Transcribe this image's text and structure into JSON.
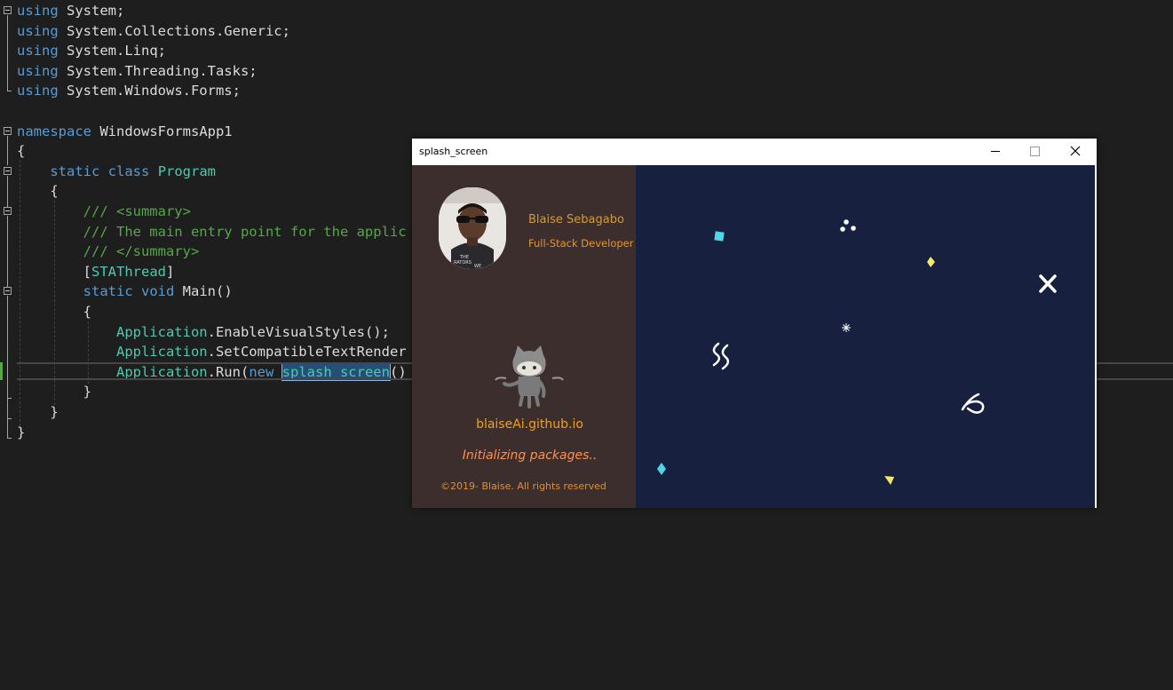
{
  "editor": {
    "lines": [
      {
        "tokens": [
          {
            "t": "using",
            "c": "kw"
          },
          {
            "t": " System;",
            "c": "id"
          }
        ]
      },
      {
        "tokens": [
          {
            "t": "using",
            "c": "kw"
          },
          {
            "t": " System.Collections.Generic;",
            "c": "id"
          }
        ]
      },
      {
        "tokens": [
          {
            "t": "using",
            "c": "kw"
          },
          {
            "t": " System.Linq;",
            "c": "id"
          }
        ]
      },
      {
        "tokens": [
          {
            "t": "using",
            "c": "kw"
          },
          {
            "t": " System.Threading.Tasks;",
            "c": "id"
          }
        ]
      },
      {
        "tokens": [
          {
            "t": "using",
            "c": "kw"
          },
          {
            "t": " System.Windows.Forms;",
            "c": "id"
          }
        ]
      },
      {
        "tokens": []
      },
      {
        "tokens": [
          {
            "t": "namespace",
            "c": "kw"
          },
          {
            "t": " WindowsFormsApp1",
            "c": "id"
          }
        ]
      },
      {
        "tokens": [
          {
            "t": "{",
            "c": "id"
          }
        ]
      },
      {
        "tokens": [
          {
            "t": "    ",
            "c": "id"
          },
          {
            "t": "static",
            "c": "kw"
          },
          {
            "t": " ",
            "c": "id"
          },
          {
            "t": "class",
            "c": "kw"
          },
          {
            "t": " ",
            "c": "id"
          },
          {
            "t": "Program",
            "c": "ty"
          }
        ]
      },
      {
        "tokens": [
          {
            "t": "    {",
            "c": "id"
          }
        ]
      },
      {
        "tokens": [
          {
            "t": "        /// <summary>",
            "c": "cm"
          }
        ]
      },
      {
        "tokens": [
          {
            "t": "        /// The main entry point for the applic",
            "c": "cm"
          }
        ]
      },
      {
        "tokens": [
          {
            "t": "        /// </summary>",
            "c": "cm"
          }
        ]
      },
      {
        "tokens": [
          {
            "t": "        [",
            "c": "id"
          },
          {
            "t": "STAThread",
            "c": "ty"
          },
          {
            "t": "]",
            "c": "id"
          }
        ]
      },
      {
        "tokens": [
          {
            "t": "        ",
            "c": "id"
          },
          {
            "t": "static",
            "c": "kw"
          },
          {
            "t": " ",
            "c": "id"
          },
          {
            "t": "void",
            "c": "kw"
          },
          {
            "t": " Main()",
            "c": "id"
          }
        ]
      },
      {
        "tokens": [
          {
            "t": "        {",
            "c": "id"
          }
        ]
      },
      {
        "tokens": [
          {
            "t": "            ",
            "c": "id"
          },
          {
            "t": "Application",
            "c": "ty"
          },
          {
            "t": ".EnableVisualStyles();",
            "c": "id"
          }
        ]
      },
      {
        "tokens": [
          {
            "t": "            ",
            "c": "id"
          },
          {
            "t": "Application",
            "c": "ty"
          },
          {
            "t": ".SetCompatibleTextRender",
            "c": "id"
          }
        ]
      },
      {
        "tokens": [
          {
            "t": "            ",
            "c": "id"
          },
          {
            "t": "Application",
            "c": "ty"
          },
          {
            "t": ".Run(",
            "c": "id"
          },
          {
            "t": "new",
            "c": "kw"
          },
          {
            "t": " ",
            "c": "id"
          },
          {
            "t": "splash_screen",
            "c": "ty sel"
          },
          {
            "t": "()",
            "c": "id"
          }
        ]
      },
      {
        "tokens": [
          {
            "t": "        }",
            "c": "id"
          }
        ]
      },
      {
        "tokens": [
          {
            "t": "    }",
            "c": "id"
          }
        ]
      },
      {
        "tokens": [
          {
            "t": "}",
            "c": "id"
          }
        ]
      }
    ]
  },
  "splash": {
    "window_title": "splash_screen",
    "name": "Blaise Sebagabo",
    "role": "Full-Stack Developer",
    "site": "blaiseAi.github.io",
    "status": "Initializing packages..",
    "copyright": "©2019- Blaise. All rights reserved",
    "colors": {
      "left_panel": "#3c2e2d",
      "right_panel": "#17213f",
      "accent_orange": "#f0a020",
      "status_orange": "#ff8f4a"
    }
  }
}
